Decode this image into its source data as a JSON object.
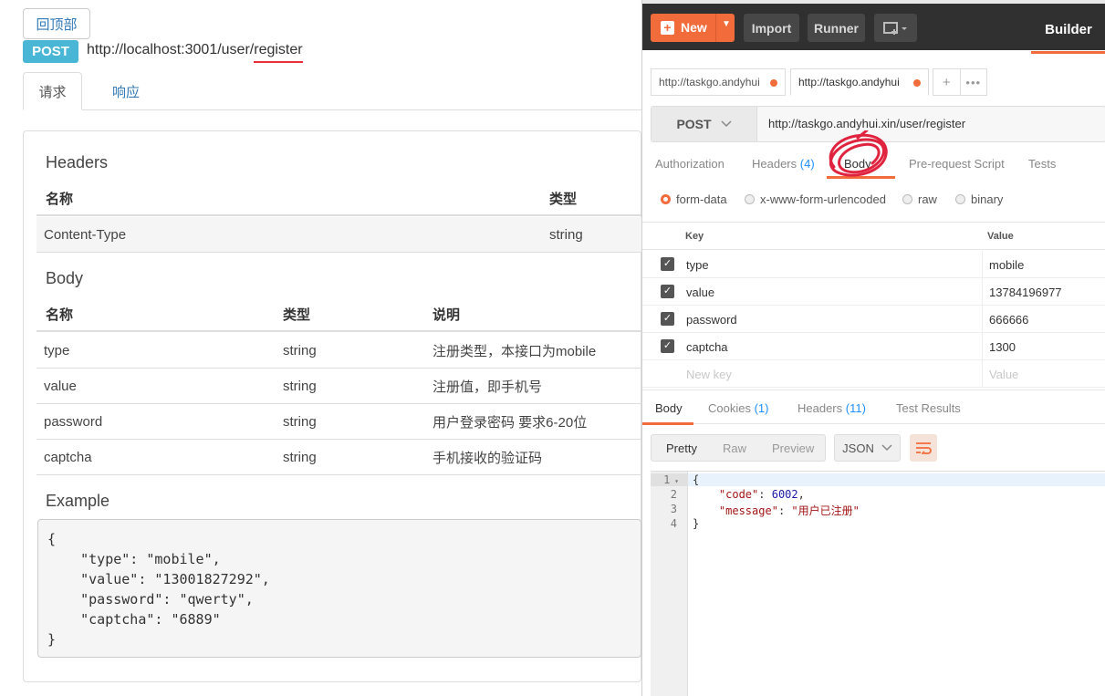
{
  "doc": {
    "back_top_label": "回顶部",
    "method": "POST",
    "endpoint_prefix": "http://localhost:3001/user/",
    "endpoint_highlight": "register",
    "tabs": [
      {
        "label": "请求"
      },
      {
        "label": "响应"
      }
    ],
    "headers_title": "Headers",
    "headers_table": {
      "columns": [
        "名称",
        "类型"
      ],
      "rows": [
        {
          "name": "Content-Type",
          "type": "string"
        }
      ]
    },
    "body_title": "Body",
    "body_table": {
      "columns": [
        "名称",
        "类型",
        "说明"
      ],
      "rows": [
        {
          "name": "type",
          "type": "string",
          "desc": "注册类型，本接口为mobile"
        },
        {
          "name": "value",
          "type": "string",
          "desc": "注册值，即手机号"
        },
        {
          "name": "password",
          "type": "string",
          "desc": "用户登录密码 要求6-20位"
        },
        {
          "name": "captcha",
          "type": "string",
          "desc": "手机接收的验证码"
        }
      ]
    },
    "example_title": "Example",
    "example_code": "{\n    \"type\": \"mobile\",\n    \"value\": \"13001827292\",\n    \"password\": \"qwerty\",\n    \"captcha\": \"6889\"\n}"
  },
  "postman": {
    "toolbar": {
      "new_label": "New",
      "import_label": "Import",
      "runner_label": "Runner",
      "builder_label": "Builder"
    },
    "request_tabs": [
      {
        "label": "http://taskgo.andyhui",
        "unsaved": true
      },
      {
        "label": "http://taskgo.andyhui",
        "unsaved": true
      }
    ],
    "method": "POST",
    "url": "http://taskgo.andyhui.xin/user/register",
    "sub_tabs": {
      "authorization": "Authorization",
      "headers": "Headers",
      "headers_count": "(4)",
      "body": "Body",
      "prerequest": "Pre-request Script",
      "tests": "Tests"
    },
    "body_modes": [
      "form-data",
      "x-www-form-urlencoded",
      "raw",
      "binary"
    ],
    "selected_mode": "form-data",
    "kv_header": {
      "key": "Key",
      "value": "Value"
    },
    "kv_rows": [
      {
        "key": "type",
        "value": "mobile"
      },
      {
        "key": "value",
        "value": "13784196977"
      },
      {
        "key": "password",
        "value": "666666"
      },
      {
        "key": "captcha",
        "value": "1300"
      }
    ],
    "kv_placeholder": {
      "key": "New key",
      "value": "Value"
    },
    "response_tabs": {
      "body": "Body",
      "cookies": "Cookies",
      "cookies_count": "(1)",
      "headers": "Headers",
      "headers_count": "(11)",
      "results": "Test Results"
    },
    "format_buttons": [
      "Pretty",
      "Raw",
      "Preview"
    ],
    "format_selected": "Pretty",
    "language": "JSON",
    "code_lines": [
      "1",
      "2",
      "3",
      "4"
    ],
    "response_json": {
      "open": "{",
      "code_key": "\"code\"",
      "code_value": "6002",
      "message_key": "\"message\"",
      "message_value": "\"用户已注册\"",
      "close": "}"
    },
    "accent_color": "#f26b3a",
    "count_color": "#1e90ff"
  }
}
